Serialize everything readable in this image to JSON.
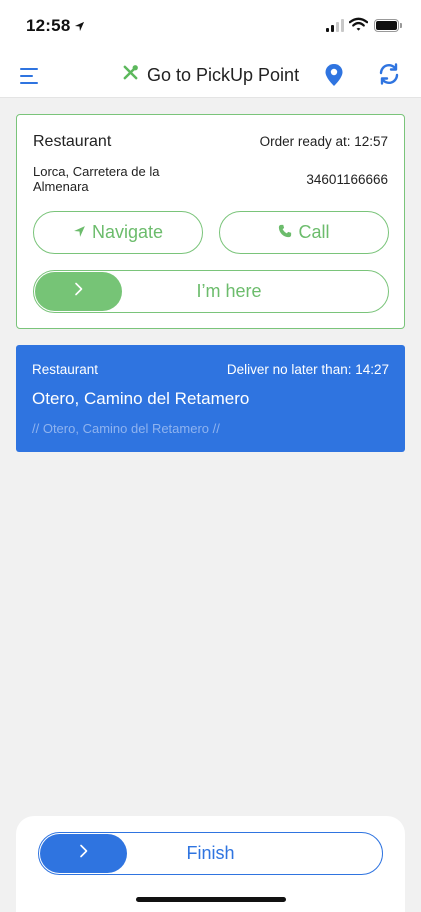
{
  "status_bar": {
    "time": "12:58"
  },
  "header": {
    "title": "Go to PickUp Point",
    "accent_color": "#2f74e0",
    "icons": [
      "menu-icon",
      "fork-knife-icon",
      "location-pin-icon",
      "refresh-icon"
    ]
  },
  "pickup": {
    "name": "Restaurant",
    "ready_text": "Order ready at: 12:57",
    "address": "Lorca, Carretera de la Almenara",
    "phone": "34601166666",
    "navigate_label": "Navigate",
    "call_label": "Call",
    "slider_label": "I’m here",
    "color": "#76c476"
  },
  "delivery": {
    "name": "Restaurant",
    "deadline_text": "Deliver no later than: 14:27",
    "address": "Otero, Camino del Retamero",
    "note": "// Otero, Camino del Retamero //",
    "color": "#2f74e0"
  },
  "footer": {
    "finish_label": "Finish"
  }
}
